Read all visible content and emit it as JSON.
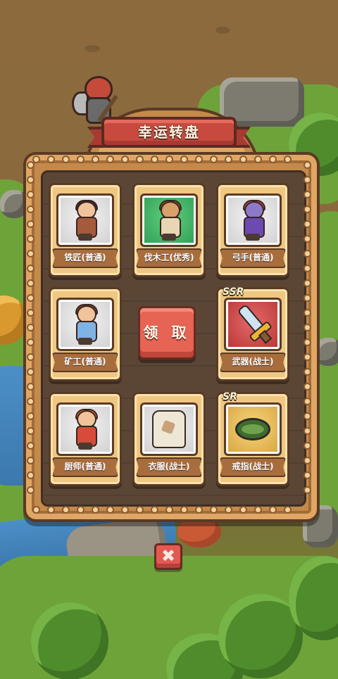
{
  "title": "幸运转盘",
  "claim_button": "领 取",
  "close_button": "✖",
  "rewards": [
    {
      "label": "铁匠(普通)",
      "icon": "blacksmith-character-icon",
      "rarity_badge": "",
      "bg": "gray"
    },
    {
      "label": "伐木工(优秀)",
      "icon": "lumberjack-monkey-icon",
      "rarity_badge": "",
      "bg": "green"
    },
    {
      "label": "弓手(普通)",
      "icon": "archer-character-icon",
      "rarity_badge": "",
      "bg": "gray"
    },
    {
      "label": "矿工(普通)",
      "icon": "miner-character-icon",
      "rarity_badge": "",
      "bg": "gray"
    },
    {
      "label": "武器(战士)",
      "icon": "sword-icon",
      "rarity_badge": "SSR",
      "bg": "red"
    },
    {
      "label": "厨师(普通)",
      "icon": "chef-character-icon",
      "rarity_badge": "",
      "bg": "gray"
    },
    {
      "label": "衣服(战士)",
      "icon": "shirt-icon",
      "rarity_badge": "",
      "bg": "gray"
    },
    {
      "label": "戒指(战士)",
      "icon": "ring-icon",
      "rarity_badge": "SR",
      "bg": "gold"
    }
  ],
  "colors": {
    "panel": "#c48a4b",
    "claim": "#e56454",
    "ribbon": "#c84a3f"
  }
}
